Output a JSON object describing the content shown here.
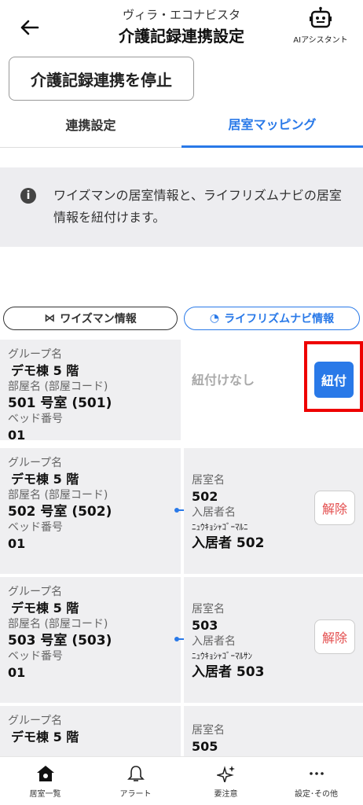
{
  "header": {
    "facility": "ヴィラ・エコナビスタ",
    "title": "介護記録連携設定",
    "ai_label": "AIアシスタント"
  },
  "stop_button": "介護記録連携を停止",
  "tabs": [
    {
      "label": "連携設定",
      "active": false
    },
    {
      "label": "居室マッピング",
      "active": true
    }
  ],
  "info": {
    "text": "ワイズマンの居室情報と、ライフリズムナビの居室情報を紐付けます。"
  },
  "columns": {
    "left": "ワイズマン情報",
    "right": "ライフリズムナビ情報"
  },
  "labels": {
    "group": "グループ名",
    "room": "部屋名 (部屋コード)",
    "bed": "ベッド番号",
    "room_name": "居室名",
    "resident": "入居者名"
  },
  "rows": [
    {
      "group": "デモ棟 5 階",
      "room": "501 号室 (501)",
      "bed": "01",
      "status": "紐付けなし",
      "action": "紐付"
    },
    {
      "group": "デモ棟 5 階",
      "room": "502 号室 (502)",
      "bed": "01",
      "room_name": "502",
      "resident_kana": "ﾆｭｳｷｮｼｬｺﾞｰﾏﾙﾆ",
      "resident": "入居者 502",
      "action": "解除"
    },
    {
      "group": "デモ棟 5 階",
      "room": "503 号室 (503)",
      "bed": "01",
      "room_name": "503",
      "resident_kana": "ﾆｭｳｷｮｼｬｺﾞｰﾏﾙｻﾝ",
      "resident": "入居者 503",
      "action": "解除"
    },
    {
      "group": "デモ棟 5 階",
      "room_name": "505"
    }
  ],
  "nav": [
    {
      "label": "居室一覧",
      "icon": "home-icon"
    },
    {
      "label": "アラート",
      "icon": "bell-icon"
    },
    {
      "label": "要注意",
      "icon": "sparkle-icon"
    },
    {
      "label": "設定･その他",
      "icon": "more-icon"
    }
  ],
  "colors": {
    "accent": "#2979e8",
    "danger": "#e34d4d",
    "highlight": "#e00000"
  }
}
